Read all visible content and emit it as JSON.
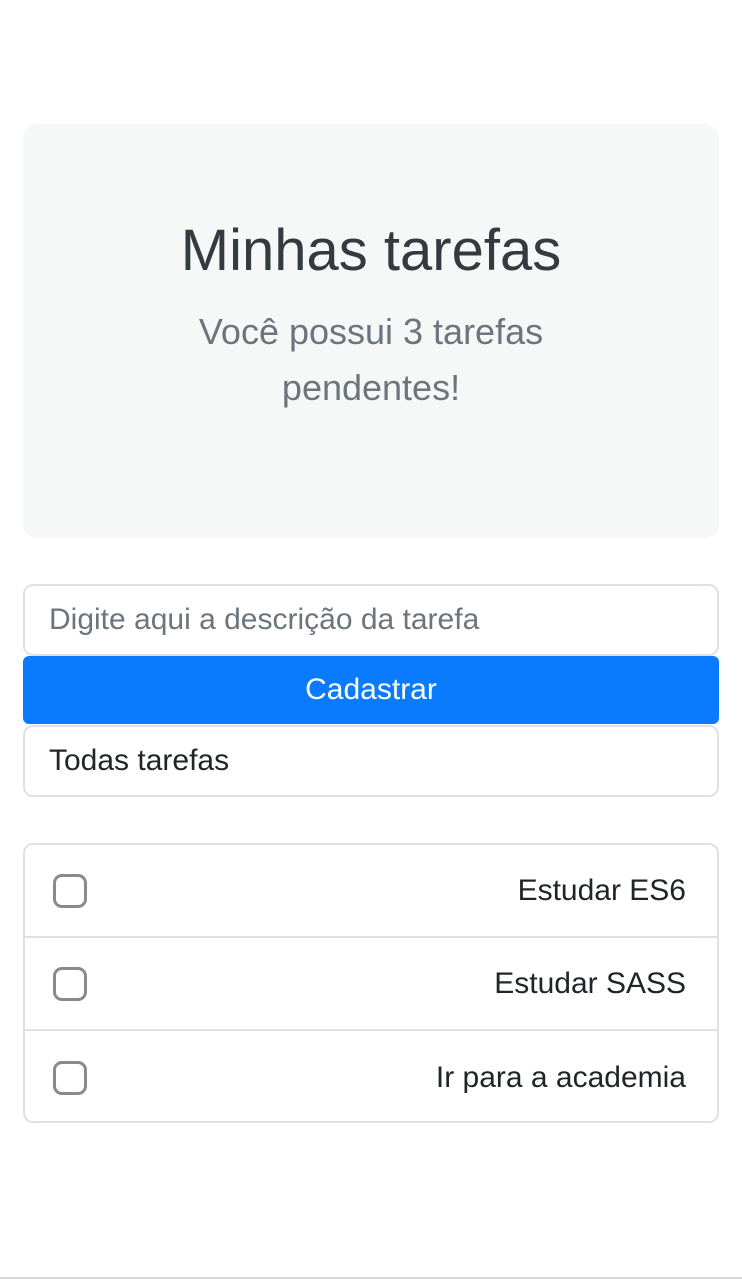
{
  "header": {
    "title": "Minhas tarefas",
    "subtitle": "Você possui 3 tarefas pendentes!"
  },
  "form": {
    "input_placeholder": "Digite aqui a descrição da tarefa",
    "input_value": "",
    "submit_label": "Cadastrar",
    "filter_selected": "Todas tarefas"
  },
  "tasks": [
    {
      "label": "Estudar ES6",
      "checked": false
    },
    {
      "label": "Estudar SASS",
      "checked": false
    },
    {
      "label": "Ir para a academia",
      "checked": false
    }
  ],
  "colors": {
    "primary": "#0a7bff",
    "jumbotron_bg": "#f6f7f7",
    "title": "#343a40",
    "muted": "#6c757d",
    "border": "#dee2e6"
  }
}
